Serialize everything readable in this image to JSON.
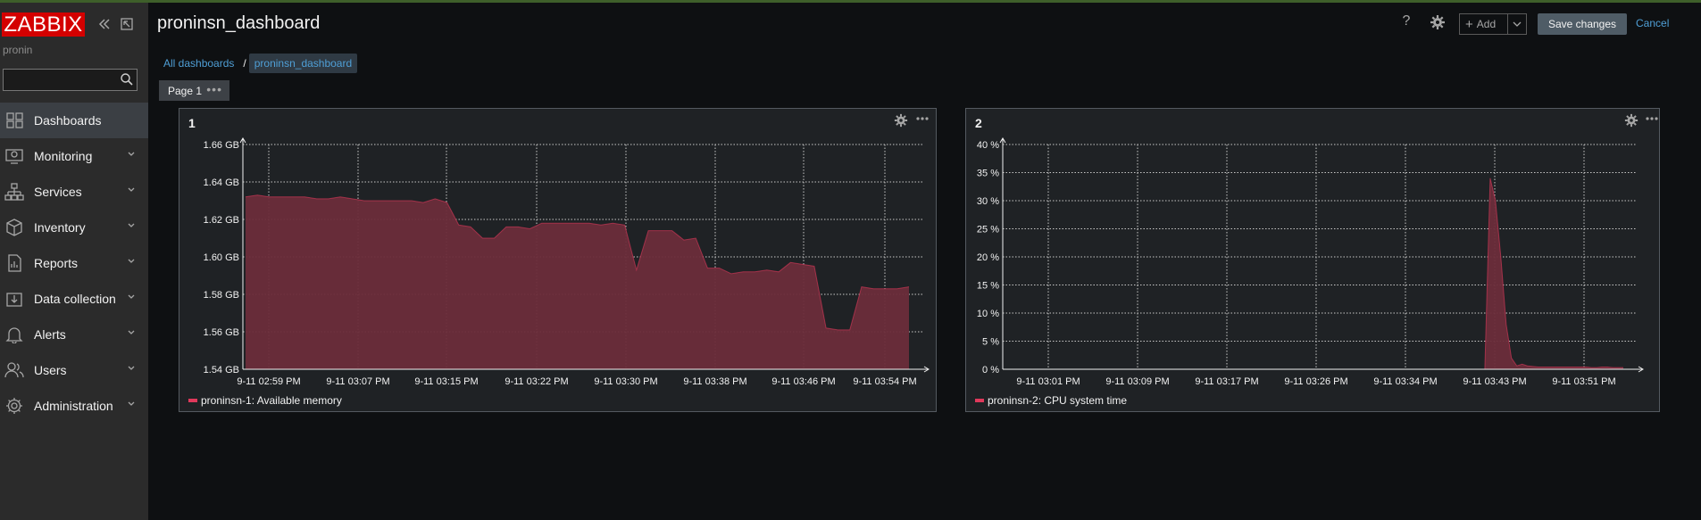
{
  "app": {
    "logo": "ZABBIX",
    "username": "pronin"
  },
  "search": {
    "placeholder": ""
  },
  "sidebar": {
    "items": [
      {
        "label": "Dashboards",
        "icon": "dashboards-icon",
        "active": true
      },
      {
        "label": "Monitoring",
        "icon": "monitoring-icon"
      },
      {
        "label": "Services",
        "icon": "services-icon"
      },
      {
        "label": "Inventory",
        "icon": "inventory-icon"
      },
      {
        "label": "Reports",
        "icon": "reports-icon"
      },
      {
        "label": "Data collection",
        "icon": "data-collection-icon"
      },
      {
        "label": "Alerts",
        "icon": "alerts-icon"
      },
      {
        "label": "Users",
        "icon": "users-icon"
      },
      {
        "label": "Administration",
        "icon": "administration-icon"
      }
    ]
  },
  "header": {
    "title": "proninsn_dashboard",
    "help": "?",
    "add_label": "Add",
    "save_label": "Save changes",
    "cancel_label": "Cancel"
  },
  "breadcrumb": {
    "root": "All dashboards",
    "separator": "/",
    "current": "proninsn_dashboard"
  },
  "page_tab": {
    "label": "Page 1",
    "menu": "•••"
  },
  "colors": {
    "accent": "#4f9fd6",
    "series": "#e0395b",
    "series_fill": "#6b2d3a",
    "logo": "#d40000"
  },
  "widgets": [
    {
      "title": "1",
      "legend": "proninsn-1: Available memory",
      "chart_data": {
        "type": "area",
        "series": [
          {
            "name": "proninsn-1: Available memory",
            "values": [
              1.632,
              1.633,
              1.632,
              1.632,
              1.632,
              1.632,
              1.631,
              1.631,
              1.632,
              1.631,
              1.63,
              1.63,
              1.63,
              1.63,
              1.63,
              1.629,
              1.631,
              1.629,
              1.617,
              1.616,
              1.61,
              1.61,
              1.616,
              1.616,
              1.615,
              1.618,
              1.618,
              1.618,
              1.618,
              1.618,
              1.617,
              1.618,
              1.617,
              1.593,
              1.614,
              1.614,
              1.614,
              1.609,
              1.61,
              1.594,
              1.594,
              1.591,
              1.592,
              1.592,
              1.593,
              1.592,
              1.597,
              1.596,
              1.595,
              1.562,
              1.561,
              1.561,
              1.584,
              1.583,
              1.583,
              1.583,
              1.584
            ]
          }
        ],
        "y_ticks": [
          "1.54 GB",
          "1.56 GB",
          "1.58 GB",
          "1.60 GB",
          "1.62 GB",
          "1.64 GB",
          "1.66 GB"
        ],
        "ylim": [
          1.54,
          1.66
        ],
        "x_ticks": [
          "9-11 02:59 PM",
          "9-11 03:07 PM",
          "9-11 03:15 PM",
          "9-11 03:22 PM",
          "9-11 03:30 PM",
          "9-11 03:38 PM",
          "9-11 03:46 PM",
          "9-11 03:54 PM"
        ],
        "grid": true
      }
    },
    {
      "title": "2",
      "legend": "proninsn-2: CPU system time",
      "chart_data": {
        "type": "area",
        "series": [
          {
            "name": "proninsn-2: CPU system time",
            "values": [
              0,
              0,
              0,
              0,
              0,
              0,
              0,
              0,
              0,
              0,
              0,
              0,
              0,
              0,
              0,
              0,
              0,
              0,
              0,
              0,
              0,
              0,
              0,
              0,
              0,
              0,
              0,
              0,
              0,
              0,
              0,
              0,
              0,
              0,
              0,
              0,
              0,
              0,
              0,
              0,
              0,
              0,
              0,
              0,
              0,
              0,
              0,
              0,
              0,
              0,
              0,
              0,
              0,
              0,
              0,
              0,
              0,
              0,
              0,
              0,
              0,
              0,
              0,
              0,
              0,
              0,
              0,
              0,
              0,
              0,
              0,
              0,
              0,
              0,
              0,
              0,
              0,
              0,
              0,
              0,
              0,
              0,
              0,
              0,
              0,
              0,
              0,
              0,
              0,
              0,
              0,
              34,
              30,
              20,
              8,
              2,
              0.6,
              0.9,
              0.6,
              0.5,
              0.4,
              0.4,
              0.4,
              0.4,
              0.4,
              0.4,
              0.4,
              0.4,
              0.4,
              0.4,
              0.3,
              0.3,
              0.4,
              0.4,
              0.3,
              0.3,
              0.3
            ]
          }
        ],
        "y_ticks": [
          "0 %",
          "5 %",
          "10 %",
          "15 %",
          "20 %",
          "25 %",
          "30 %",
          "35 %",
          "40 %"
        ],
        "ylim": [
          0,
          40
        ],
        "x_ticks": [
          "9-11 03:01 PM",
          "9-11 03:09 PM",
          "9-11 03:17 PM",
          "9-11 03:26 PM",
          "9-11 03:34 PM",
          "9-11 03:43 PM",
          "9-11 03:51 PM"
        ],
        "grid": true
      }
    }
  ]
}
